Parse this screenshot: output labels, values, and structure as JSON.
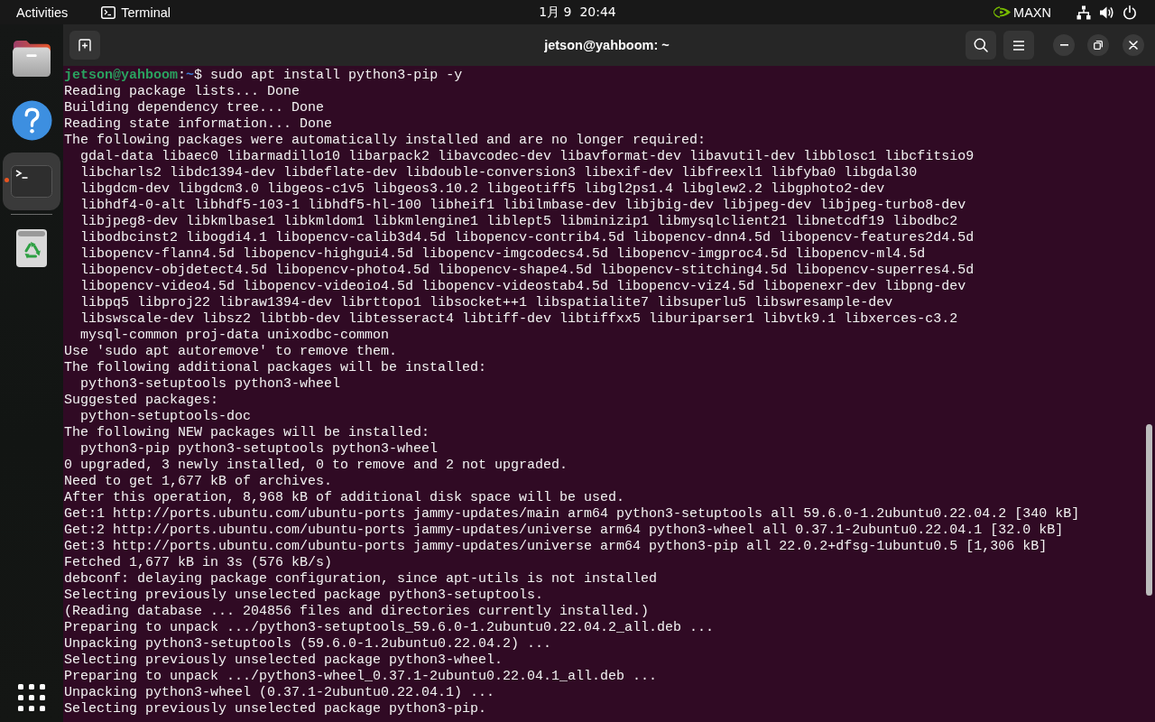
{
  "top_bar": {
    "activities": "Activities",
    "app_menu": "Terminal",
    "clock": "1月 9  20:44",
    "power_mode": "MAXN"
  },
  "dock": {
    "apps": [
      {
        "kind": "files",
        "selected": false,
        "running": false
      },
      {
        "kind": "help",
        "selected": false,
        "running": false
      },
      {
        "kind": "terminal",
        "selected": true,
        "running": true
      }
    ],
    "places": [
      {
        "kind": "trash",
        "selected": false,
        "running": false
      }
    ]
  },
  "terminal": {
    "title": "jetson@yahboom: ~",
    "lines": [
      {
        "kind": "prompt",
        "user": "jetson@yahboom",
        "separator": ":",
        "dir": "~",
        "symbol": "$",
        "command": "sudo apt install python3-pip -y"
      },
      {
        "kind": "output",
        "text": "Reading package lists... Done"
      },
      {
        "kind": "output",
        "text": "Building dependency tree... Done"
      },
      {
        "kind": "output",
        "text": "Reading state information... Done"
      },
      {
        "kind": "output",
        "text": "The following packages were automatically installed and are no longer required:"
      },
      {
        "kind": "indented",
        "text": "gdal-data libaec0 libarmadillo10 libarpack2 libavcodec-dev libavformat-dev libavutil-dev libblosc1 libcfitsio9"
      },
      {
        "kind": "indented",
        "text": "libcharls2 libdc1394-dev libdeflate-dev libdouble-conversion3 libexif-dev libfreexl1 libfyba0 libgdal30"
      },
      {
        "kind": "indented",
        "text": "libgdcm-dev libgdcm3.0 libgeos-c1v5 libgeos3.10.2 libgeotiff5 libgl2ps1.4 libglew2.2 libgphoto2-dev"
      },
      {
        "kind": "indented",
        "text": "libhdf4-0-alt libhdf5-103-1 libhdf5-hl-100 libheif1 libilmbase-dev libjbig-dev libjpeg-dev libjpeg-turbo8-dev"
      },
      {
        "kind": "indented",
        "text": "libjpeg8-dev libkmlbase1 libkmldom1 libkmlengine1 liblept5 libminizip1 libmysqlclient21 libnetcdf19 libodbc2"
      },
      {
        "kind": "indented",
        "text": "libodbcinst2 libogdi4.1 libopencv-calib3d4.5d libopencv-contrib4.5d libopencv-dnn4.5d libopencv-features2d4.5d"
      },
      {
        "kind": "indented",
        "text": "libopencv-flann4.5d libopencv-highgui4.5d libopencv-imgcodecs4.5d libopencv-imgproc4.5d libopencv-ml4.5d"
      },
      {
        "kind": "indented",
        "text": "libopencv-objdetect4.5d libopencv-photo4.5d libopencv-shape4.5d libopencv-stitching4.5d libopencv-superres4.5d"
      },
      {
        "kind": "indented",
        "text": "libopencv-video4.5d libopencv-videoio4.5d libopencv-videostab4.5d libopencv-viz4.5d libopenexr-dev libpng-dev"
      },
      {
        "kind": "indented",
        "text": "libpq5 libproj22 libraw1394-dev librttopo1 libsocket++1 libspatialite7 libsuperlu5 libswresample-dev"
      },
      {
        "kind": "indented",
        "text": "libswscale-dev libsz2 libtbb-dev libtesseract4 libtiff-dev libtiffxx5 liburiparser1 libvtk9.1 libxerces-c3.2"
      },
      {
        "kind": "indented",
        "text": "mysql-common proj-data unixodbc-common"
      },
      {
        "kind": "output",
        "text": "Use 'sudo apt autoremove' to remove them."
      },
      {
        "kind": "output",
        "text": "The following additional packages will be installed:"
      },
      {
        "kind": "indented",
        "text": "python3-setuptools python3-wheel"
      },
      {
        "kind": "output",
        "text": "Suggested packages:"
      },
      {
        "kind": "indented",
        "text": "python-setuptools-doc"
      },
      {
        "kind": "output",
        "text": "The following NEW packages will be installed:"
      },
      {
        "kind": "indented",
        "text": "python3-pip python3-setuptools python3-wheel"
      },
      {
        "kind": "output",
        "text": "0 upgraded, 3 newly installed, 0 to remove and 2 not upgraded."
      },
      {
        "kind": "output",
        "text": "Need to get 1,677 kB of archives."
      },
      {
        "kind": "output",
        "text": "After this operation, 8,968 kB of additional disk space will be used."
      },
      {
        "kind": "output",
        "text": "Get:1 http://ports.ubuntu.com/ubuntu-ports jammy-updates/main arm64 python3-setuptools all 59.6.0-1.2ubuntu0.22.04.2 [340 kB]"
      },
      {
        "kind": "output",
        "text": "Get:2 http://ports.ubuntu.com/ubuntu-ports jammy-updates/universe arm64 python3-wheel all 0.37.1-2ubuntu0.22.04.1 [32.0 kB]"
      },
      {
        "kind": "output",
        "text": "Get:3 http://ports.ubuntu.com/ubuntu-ports jammy-updates/universe arm64 python3-pip all 22.0.2+dfsg-1ubuntu0.5 [1,306 kB]"
      },
      {
        "kind": "output",
        "text": "Fetched 1,677 kB in 3s (576 kB/s)"
      },
      {
        "kind": "output",
        "text": "debconf: delaying package configuration, since apt-utils is not installed"
      },
      {
        "kind": "output",
        "text": "Selecting previously unselected package python3-setuptools."
      },
      {
        "kind": "output",
        "text": "(Reading database ... 204856 files and directories currently installed.)"
      },
      {
        "kind": "output",
        "text": "Preparing to unpack .../python3-setuptools_59.6.0-1.2ubuntu0.22.04.2_all.deb ..."
      },
      {
        "kind": "output",
        "text": "Unpacking python3-setuptools (59.6.0-1.2ubuntu0.22.04.2) ..."
      },
      {
        "kind": "output",
        "text": "Selecting previously unselected package python3-wheel."
      },
      {
        "kind": "output",
        "text": "Preparing to unpack .../python3-wheel_0.37.1-2ubuntu0.22.04.1_all.deb ..."
      },
      {
        "kind": "output",
        "text": "Unpacking python3-wheel (0.37.1-2ubuntu0.22.04.1) ..."
      },
      {
        "kind": "output",
        "text": "Selecting previously unselected package python3-pip."
      }
    ]
  }
}
